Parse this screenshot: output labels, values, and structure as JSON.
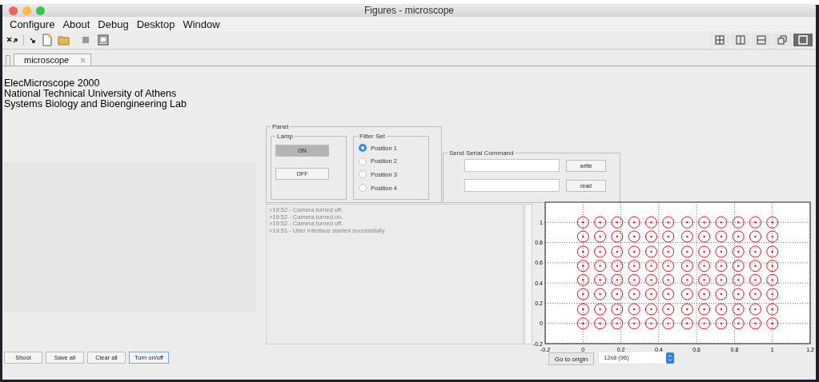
{
  "window": {
    "title": "Figures - microscope"
  },
  "menu": [
    "Configure",
    "About",
    "Debug",
    "Desktop",
    "Window"
  ],
  "layout_buttons": [
    {
      "kind": "grid",
      "selected": false
    },
    {
      "kind": "columns",
      "selected": false
    },
    {
      "kind": "rows",
      "selected": false
    },
    {
      "kind": "float",
      "selected": false
    },
    {
      "kind": "single",
      "selected": true
    }
  ],
  "tabs": [
    {
      "label": "microscope",
      "selected": true
    }
  ],
  "header_lines": [
    "ElecMicroscope 2000",
    "National Technical University of Athens",
    "Systems Biology and Bioengineering Lab"
  ],
  "panel": {
    "title": "Panel",
    "lamp": {
      "title": "Lamp",
      "buttons": [
        {
          "label": "ON",
          "pressed": true
        },
        {
          "label": "OFF",
          "pressed": false
        }
      ]
    },
    "filter_set": {
      "title": "Filter Set",
      "options": [
        {
          "label": "Position 1",
          "selected": true
        },
        {
          "label": "Position 2",
          "selected": false
        },
        {
          "label": "Position 3",
          "selected": false
        },
        {
          "label": "Position 4",
          "selected": false
        }
      ]
    }
  },
  "serial": {
    "title": "Send Serial Command",
    "write_button": "write",
    "read_button": "read"
  },
  "log": [
    ">19:52 - Camera turned off.",
    ">19:52 - Camera turned on.",
    ">19:52 - Camera turned off.",
    ">19:51 - User Interface started successfully"
  ],
  "plot": {
    "chart_data": {
      "type": "scatter",
      "grid": true,
      "xlim": [
        -0.2,
        1.2
      ],
      "ylim": [
        -0.2,
        1.2
      ],
      "xticks": [
        {
          "value": -0.2,
          "label": "-0.2"
        },
        {
          "value": 0,
          "label": "0"
        },
        {
          "value": 0.2,
          "label": "0.2"
        },
        {
          "value": 0.4,
          "label": "0.4"
        },
        {
          "value": 0.6,
          "label": "0.6"
        },
        {
          "value": 0.8,
          "label": "0.8"
        },
        {
          "value": 1,
          "label": "1"
        },
        {
          "value": 1.2,
          "label": "1.2"
        }
      ],
      "yticks": [
        {
          "value": -0.2,
          "label": "-0.2"
        },
        {
          "value": 0,
          "label": "0"
        },
        {
          "value": 0.2,
          "label": "0.2"
        },
        {
          "value": 0.4,
          "label": "0.4"
        },
        {
          "value": 0.6,
          "label": "0.6"
        },
        {
          "value": 0.8,
          "label": "0.8"
        },
        {
          "value": 1,
          "label": "1"
        }
      ],
      "x": [
        0,
        0.09,
        0.18,
        0.27,
        0.36,
        0.45,
        0.55,
        0.64,
        0.73,
        0.82,
        0.91,
        1,
        0,
        0.09,
        0.18,
        0.27,
        0.36,
        0.45,
        0.55,
        0.64,
        0.73,
        0.82,
        0.91,
        1,
        0,
        0.09,
        0.18,
        0.27,
        0.36,
        0.45,
        0.55,
        0.64,
        0.73,
        0.82,
        0.91,
        1,
        0,
        0.09,
        0.18,
        0.27,
        0.36,
        0.45,
        0.55,
        0.64,
        0.73,
        0.82,
        0.91,
        1,
        0,
        0.09,
        0.18,
        0.27,
        0.36,
        0.45,
        0.55,
        0.64,
        0.73,
        0.82,
        0.91,
        1,
        0,
        0.09,
        0.18,
        0.27,
        0.36,
        0.45,
        0.55,
        0.64,
        0.73,
        0.82,
        0.91,
        1,
        0,
        0.09,
        0.18,
        0.27,
        0.36,
        0.45,
        0.55,
        0.64,
        0.73,
        0.82,
        0.91,
        1,
        0,
        0.09,
        0.18,
        0.27,
        0.36,
        0.45,
        0.55,
        0.64,
        0.73,
        0.82,
        0.91,
        1
      ],
      "values": [
        0,
        0,
        0,
        0,
        0,
        0,
        0,
        0,
        0,
        0,
        0,
        0,
        0.14,
        0.14,
        0.14,
        0.14,
        0.14,
        0.14,
        0.14,
        0.14,
        0.14,
        0.14,
        0.14,
        0.14,
        0.29,
        0.29,
        0.29,
        0.29,
        0.29,
        0.29,
        0.29,
        0.29,
        0.29,
        0.29,
        0.29,
        0.29,
        0.43,
        0.43,
        0.43,
        0.43,
        0.43,
        0.43,
        0.43,
        0.43,
        0.43,
        0.43,
        0.43,
        0.43,
        0.57,
        0.57,
        0.57,
        0.57,
        0.57,
        0.57,
        0.57,
        0.57,
        0.57,
        0.57,
        0.57,
        0.57,
        0.71,
        0.71,
        0.71,
        0.71,
        0.71,
        0.71,
        0.71,
        0.71,
        0.71,
        0.71,
        0.71,
        0.71,
        0.86,
        0.86,
        0.86,
        0.86,
        0.86,
        0.86,
        0.86,
        0.86,
        0.86,
        0.86,
        0.86,
        0.86,
        1,
        1,
        1,
        1,
        1,
        1,
        1,
        1,
        1,
        1,
        1,
        1
      ]
    }
  },
  "goto_button": "Go to origin",
  "grid_select": {
    "value": "12x8 (96)"
  },
  "bottom_buttons": [
    {
      "label": "Shoot",
      "focused": false
    },
    {
      "label": "Save all",
      "focused": false
    },
    {
      "label": "Clear all",
      "focused": false
    },
    {
      "label": "Turn on/off",
      "focused": true
    }
  ]
}
